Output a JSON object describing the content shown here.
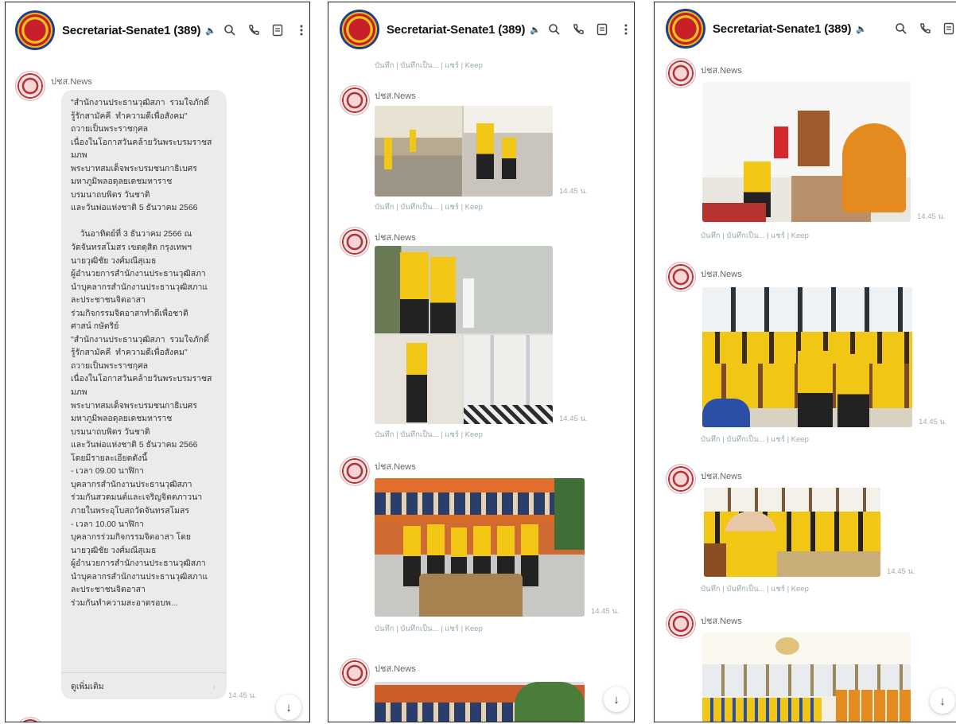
{
  "chat": {
    "title": "Secretariat-Senate1 (389)",
    "mute_glyph": "🔈"
  },
  "icons": [
    "search-icon",
    "phone-icon",
    "notes-icon",
    "menu-dots-icon",
    "scroll-down-icon"
  ],
  "sender": "ปชส.News",
  "time": "14.45 น.",
  "actions": "บันทึก | บันทึกเป็น... | แชร์ | Keep",
  "message": {
    "text": "\"สำนักงานประธานวุฒิสภา  รวมใจภักดิ์\nรู้รักสามัคคี  ทำความดีเพื่อสังคม\"\nถวายเป็นพระราชกุศล\nเนื่องในโอกาสวันคล้ายวันพระบรมราชส\nมภพ\nพระบาทสมเด็จพระบรมชนกาธิเบศร\nมหาภูมิพลอดุลยเดชมหาราช\nบรมนาถบพิตร วันชาติ\nและวันพ่อแห่งชาติ 5 ธันวาคม 2566\n\n    วันอาทิตย์ที่ 3 ธันวาคม 2566 ณ\nวัดจันทรสโมสร เขตดุสิต กรุงเทพฯ\nนายวุฒิชัย วงศ์มณีสุเมธ\nผู้อำนวยการสำนักงานประธานวุฒิสภา\nนำบุคลากรสำนักงานประธานวุฒิสภาแ\nละประชาชนจิตอาสา\nร่วมกิจกรรมจิตอาสาทำดีเพื่อชาติ\nศาสน์ กษัตริย์\n\"สำนักงานประธานวุฒิสภา  รวมใจภักดิ์\nรู้รักสามัคคี  ทำความดีเพื่อสังคม\"\nถวายเป็นพระราชกุศล\nเนื่องในโอกาสวันคล้ายวันพระบรมราชส\nมภพ\nพระบาทสมเด็จพระบรมชนกาธิเบศร\nมหาภูมิพลอดุลยเดชมหาราช\nบรมนาถบพิตร วันชาติ\nและวันพ่อแห่งชาติ 5 ธันวาคม 2566\nโดยมีรายละเอียดดังนี้\n- เวลา 09.00 นาฬิกา\nบุคลากรสำนักงานประธานวุฒิสภา\nร่วมกันสวดมนต์และเจริญจิตตภาวนา\nภายในพระอุโบสถวัดจันทรสโมสร\n- เวลา 10.00 นาฬิกา\nบุคลากรร่วมกิจกรรมจิตอาสา โดย\nนายวุฒิชัย วงศ์มณีสุเมธ\nผู้อำนวยการสำนักงานประธานวุฒิสภา\nนำบุคลากรสำนักงานประธานวุฒิสภาแ\nละประชาชนจิตอาสา\nร่วมกันทำความสะอาดรอบพ...",
    "read_more": "ดูเพิ่มเติม"
  },
  "colors": {
    "bubble": "#ebebeb",
    "shirt_yellow": "#f2c615",
    "robe_orange": "#e58a1f"
  }
}
